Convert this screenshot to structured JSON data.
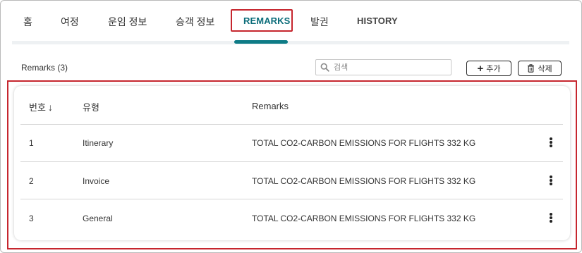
{
  "tabs": [
    {
      "label": "홈"
    },
    {
      "label": "여정"
    },
    {
      "label": "운임 정보"
    },
    {
      "label": "승객 정보"
    },
    {
      "label": "REMARKS",
      "active": true
    },
    {
      "label": "발권"
    },
    {
      "label": "HISTORY"
    }
  ],
  "toolbar": {
    "remarks_count": "Remarks (3)",
    "search_placeholder": "검색",
    "add_label": "추가",
    "add_icon": "plus-icon",
    "delete_label": "삭제",
    "delete_icon": "trash-icon"
  },
  "table": {
    "columns": {
      "number": "번호",
      "type": "유형",
      "remarks": "Remarks"
    },
    "sort": {
      "column": "number",
      "direction": "descending-arrow"
    },
    "rows": [
      {
        "number": "1",
        "type": "Itinerary",
        "remarks": "TOTAL CO2-CARBON EMISSIONS FOR FLIGHTS 332 KG"
      },
      {
        "number": "2",
        "type": "Invoice",
        "remarks": "TOTAL CO2-CARBON EMISSIONS FOR FLIGHTS 332 KG"
      },
      {
        "number": "3",
        "type": "General",
        "remarks": "TOTAL CO2-CARBON EMISSIONS FOR FLIGHTS 332 KG"
      }
    ],
    "row_action_icon": "more-vertical-icon"
  },
  "colors": {
    "accent": "#0e7b86",
    "highlight_border": "#c6262e"
  }
}
